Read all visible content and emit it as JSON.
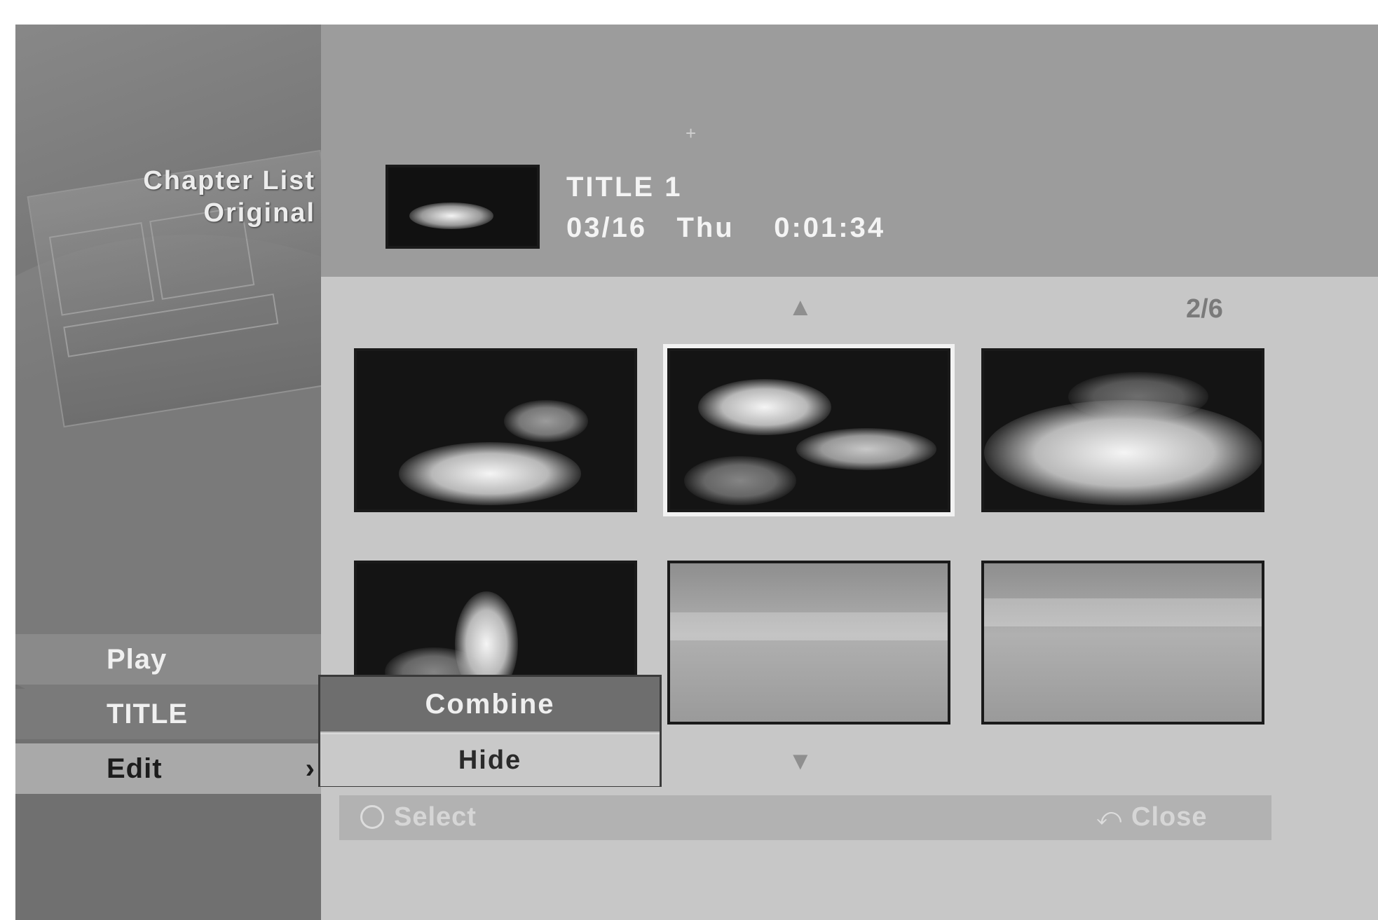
{
  "sidebar": {
    "menu_title_line1": "Chapter List",
    "menu_title_line2": "Original",
    "items": [
      {
        "label": "Play"
      },
      {
        "label": "TITLE"
      },
      {
        "label": "Edit",
        "arrow": "›"
      }
    ]
  },
  "header": {
    "title": "TITLE  1",
    "info": "03/16   Thu    0:01:34"
  },
  "grid": {
    "page_indicator": "2/6",
    "scroll_up_glyph": "▲",
    "scroll_down_glyph": "▼"
  },
  "popup": {
    "combine_label": "Combine",
    "hide_label": "Hide"
  },
  "footer": {
    "select_label": "Select",
    "close_label": "Close",
    "select_icon": "select-circle-icon",
    "close_icon": "return-arrow-icon"
  }
}
